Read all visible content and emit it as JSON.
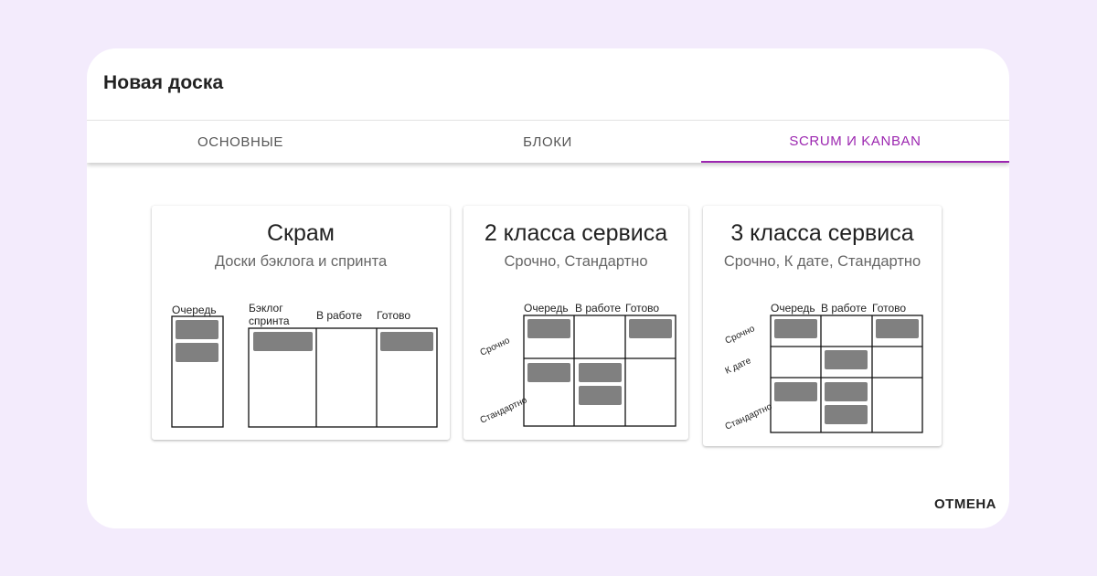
{
  "dialog": {
    "title": "Новая доска",
    "cancel_label": "ОТМЕНА"
  },
  "tabs": [
    {
      "label": "ОСНОВНЫЕ",
      "active": false
    },
    {
      "label": "БЛОКИ",
      "active": false
    },
    {
      "label": "SCRUM И KANBAN",
      "active": true
    }
  ],
  "accent_color": "#9c27b0",
  "cards": [
    {
      "title": "Скрам",
      "subtitle": "Доски бэклога и спринта",
      "labels": {
        "queue": "Очередь",
        "sprint_backlog_1": "Бэклог",
        "sprint_backlog_2": "спринта",
        "in_progress": "В работе",
        "done": "Готово"
      }
    },
    {
      "title": "2 класса сервиса",
      "subtitle": "Срочно, Стандартно",
      "labels": {
        "queue": "Очередь",
        "in_progress": "В работе",
        "done": "Готово",
        "urgent": "Срочно",
        "standard": "Стандартно"
      }
    },
    {
      "title": "3 класса сервиса",
      "subtitle": "Срочно, К дате, Стандартно",
      "labels": {
        "queue": "Очередь",
        "in_progress": "В работе",
        "done": "Готово",
        "urgent": "Срочно",
        "by_date": "К дате",
        "standard": "Стандартно"
      }
    }
  ]
}
